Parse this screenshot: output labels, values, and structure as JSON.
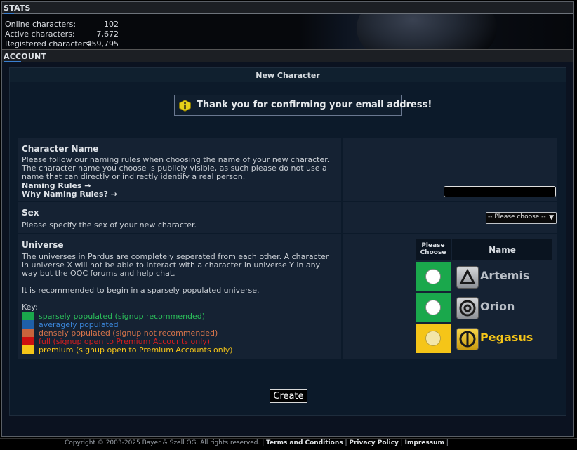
{
  "stats": {
    "tab_label_accent": "ST",
    "tab_label_rest": "ATS",
    "rows": [
      {
        "label": "Online characters:",
        "value": "102"
      },
      {
        "label": "Active characters:",
        "value": "7,672"
      },
      {
        "label": "Registered characters:",
        "value": "459,795"
      }
    ]
  },
  "account": {
    "tab_label_accent": "ACC",
    "tab_label_rest": "OUNT"
  },
  "panel": {
    "title": "New Character",
    "notice": "Thank you for confirming your email address!",
    "character_name": {
      "title": "Character Name",
      "description": "Please follow our naming rules when choosing the name of your new character. The character name you choose is publicly visible, as such please do not use a name that can directly or indirectly identify a real person.",
      "link1": "Naming Rules →",
      "link2": "Why Naming Rules? →",
      "input_value": ""
    },
    "sex": {
      "title": "Sex",
      "description": "Please specify the sex of your new character.",
      "select_value": "-- Please choose --"
    },
    "universe": {
      "title": "Universe",
      "description": "The universes in Pardus are completely seperated from each other. A character in universe X will not be able to interact with a character in universe Y in any way but the OOC forums and help chat.",
      "recommendation": "It is recommended to begin in a sparsely populated universe.",
      "key_label": "Key:",
      "key": [
        {
          "text": "sparsely populated (signup recommended)",
          "color": "#1aa84c",
          "text_color": "#2bbf5a"
        },
        {
          "text": "averagely populated",
          "color": "#1e5fa8",
          "text_color": "#3a84d6"
        },
        {
          "text": "densely populated (signup not recommended)",
          "color": "#c8643c",
          "text_color": "#d6744a"
        },
        {
          "text": "full (signup open to Premium Accounts only)",
          "color": "#cc1010",
          "text_color": "#d41e1e"
        },
        {
          "text": "premium (signup open to Premium Accounts only)",
          "color": "#f5c518",
          "text_color": "#f5c518"
        }
      ],
      "header_choose": "Please Choose",
      "header_name": "Name",
      "options": [
        {
          "name": "Artemis",
          "cell_color": "#1aa84c",
          "name_color": "#b8bec6",
          "icon": "triangle-icon"
        },
        {
          "name": "Orion",
          "cell_color": "#1aa84c",
          "name_color": "#b8bec6",
          "icon": "circle-target-icon"
        },
        {
          "name": "Pegasus",
          "cell_color": "#f5c518",
          "name_color": "#f5c518",
          "icon": "circle-bar-icon"
        }
      ]
    },
    "create_label": "Create"
  },
  "footer": {
    "copyright": "Copyright © 2003-2025 Bayer & Szell OG. All rights reserved. |",
    "links": [
      "Terms and Conditions",
      "Privacy Policy",
      "Impressum"
    ]
  }
}
